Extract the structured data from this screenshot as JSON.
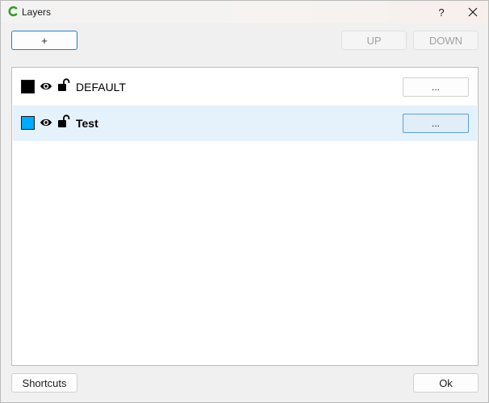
{
  "window": {
    "title": "Layers",
    "help_label": "?"
  },
  "toolbar": {
    "add_label": "+",
    "up_label": "UP",
    "down_label": "DOWN"
  },
  "layers": [
    {
      "name": "DEFAULT",
      "color": "#000000",
      "visible": true,
      "locked": false,
      "more_label": "...",
      "selected": false
    },
    {
      "name": "Test",
      "color": "#00aaff",
      "visible": true,
      "locked": false,
      "more_label": "...",
      "selected": true
    }
  ],
  "footer": {
    "shortcuts_label": "Shortcuts",
    "ok_label": "Ok"
  },
  "colors": {
    "accent": "#2a7cc7",
    "selection": "#e5f1fb",
    "app_icon": "#3a9a2a"
  }
}
